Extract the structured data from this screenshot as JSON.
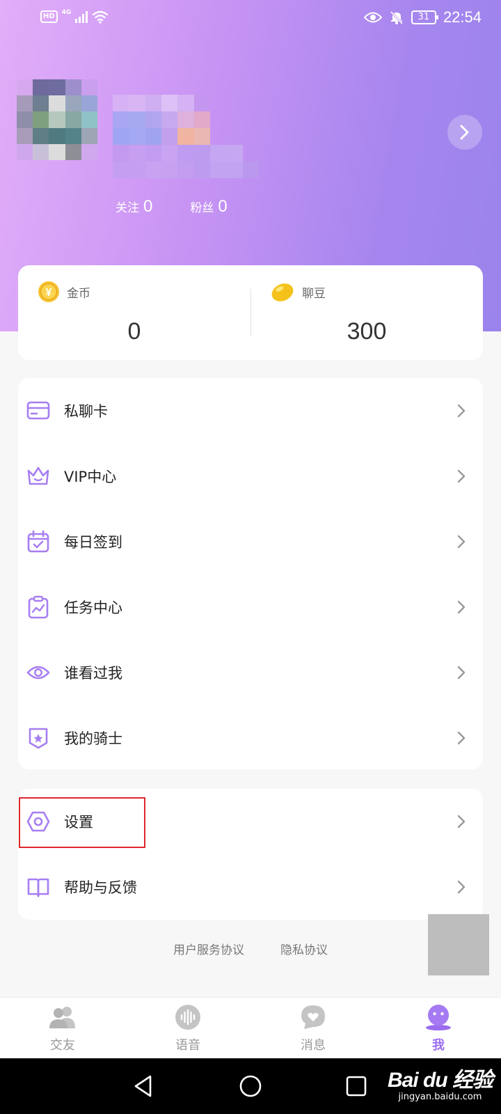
{
  "status_bar": {
    "hd": "HD",
    "network": "4G",
    "battery": "31",
    "time": "22:54"
  },
  "profile": {
    "follow_label": "关注",
    "follow_count": "0",
    "fans_label": "粉丝",
    "fans_count": "0"
  },
  "wallet": {
    "coins_label": "金币",
    "coins_value": "0",
    "beans_label": "聊豆",
    "beans_value": "300"
  },
  "menu": {
    "items": [
      {
        "label": "私聊卡",
        "icon": "card-icon"
      },
      {
        "label": "VIP中心",
        "icon": "crown-icon"
      },
      {
        "label": "每日签到",
        "icon": "calendar-check-icon"
      },
      {
        "label": "任务中心",
        "icon": "clipboard-chart-icon"
      },
      {
        "label": "谁看过我",
        "icon": "eye-icon"
      },
      {
        "label": "我的骑士",
        "icon": "shield-star-icon"
      }
    ],
    "secondary": [
      {
        "label": "设置",
        "icon": "settings-hexagon-icon"
      },
      {
        "label": "帮助与反馈",
        "icon": "book-icon"
      }
    ]
  },
  "links": {
    "terms": "用户服务协议",
    "privacy": "隐私协议"
  },
  "tabs": [
    {
      "label": "交友",
      "icon": "friends-icon"
    },
    {
      "label": "语音",
      "icon": "voice-wave-icon"
    },
    {
      "label": "消息",
      "icon": "message-heart-icon"
    },
    {
      "label": "我",
      "icon": "me-avatar-icon"
    }
  ],
  "watermark": {
    "logo": "Bai du 经验",
    "url": "jingyan.baidu.com"
  },
  "colors": {
    "accent": "#9b6cf0",
    "header_start": "#e2aef9",
    "header_end": "#9a83ec",
    "highlight": "#e0262d"
  }
}
